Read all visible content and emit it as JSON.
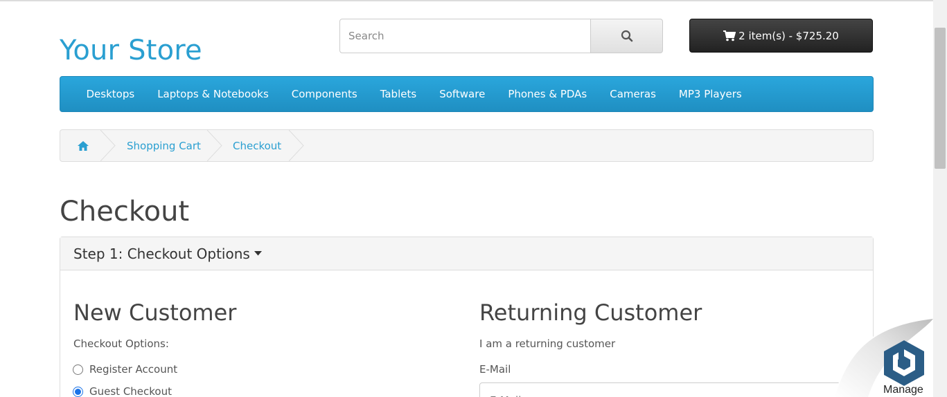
{
  "header": {
    "logo": "Your Store",
    "search": {
      "placeholder": "Search",
      "icon": "search-icon"
    },
    "cart": {
      "label": "2 item(s) - $725.20",
      "icon": "shopping-cart-icon"
    }
  },
  "nav": {
    "items": [
      "Desktops",
      "Laptops & Notebooks",
      "Components",
      "Tablets",
      "Software",
      "Phones & PDAs",
      "Cameras",
      "MP3 Players"
    ]
  },
  "breadcrumb": {
    "home_icon": "home-icon",
    "items": [
      "Shopping Cart",
      "Checkout"
    ]
  },
  "page": {
    "title": "Checkout"
  },
  "panel": {
    "heading": "Step 1: Checkout Options",
    "heading_icon": "caret-down-icon",
    "new_customer": {
      "title": "New Customer",
      "options_label": "Checkout Options:",
      "options": [
        {
          "label": "Register Account",
          "checked": false
        },
        {
          "label": "Guest Checkout",
          "checked": true
        }
      ]
    },
    "returning_customer": {
      "title": "Returning Customer",
      "subtitle": "I am a returning customer",
      "email_label": "E-Mail",
      "email_placeholder": "E-Mail"
    }
  },
  "widget": {
    "label": "Manage",
    "icon": "manage-logo-icon"
  },
  "colors": {
    "brand": "#2a9fd1",
    "nav_bg": "#229ac8",
    "cart_bg": "#2b2b2b"
  }
}
